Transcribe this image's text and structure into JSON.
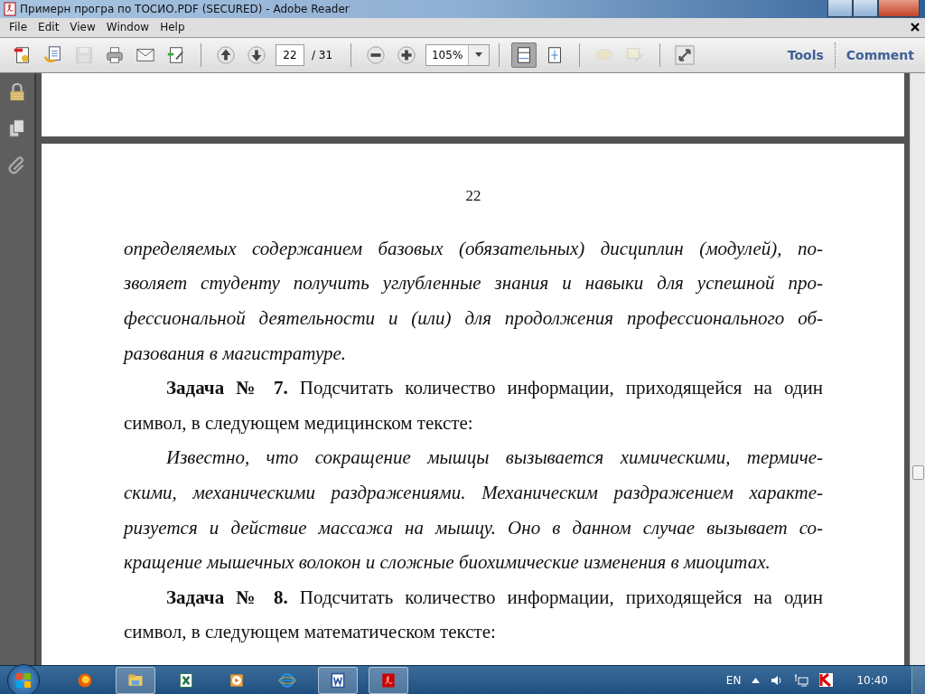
{
  "window": {
    "title": "Примерн програ по ТОСИО.PDF (SECURED) - Adobe Reader"
  },
  "menu": [
    "File",
    "Edit",
    "View",
    "Window",
    "Help"
  ],
  "toolbar": {
    "buttons": [
      {
        "kind": "create",
        "disabled": false,
        "pressed": false
      },
      {
        "kind": "open",
        "disabled": false,
        "pressed": false
      },
      {
        "kind": "save",
        "disabled": true,
        "pressed": false
      },
      {
        "kind": "print",
        "disabled": false,
        "pressed": false
      },
      {
        "kind": "email",
        "disabled": false,
        "pressed": false
      },
      {
        "kind": "sign",
        "disabled": false,
        "pressed": false
      },
      {
        "kind": "sep"
      },
      {
        "kind": "prev",
        "disabled": false,
        "pressed": false
      },
      {
        "kind": "next",
        "disabled": false,
        "pressed": false
      },
      {
        "kind": "page"
      },
      {
        "kind": "sep"
      },
      {
        "kind": "zoomout",
        "disabled": false,
        "pressed": false
      },
      {
        "kind": "zoomin",
        "disabled": false,
        "pressed": false
      },
      {
        "kind": "zoom"
      },
      {
        "kind": "sep"
      },
      {
        "kind": "fitpage",
        "disabled": false,
        "pressed": true
      },
      {
        "kind": "fitwidth",
        "disabled": false,
        "pressed": false
      },
      {
        "kind": "sep"
      },
      {
        "kind": "note",
        "disabled": true,
        "pressed": false
      },
      {
        "kind": "textedit",
        "disabled": true,
        "pressed": false
      },
      {
        "kind": "sep"
      },
      {
        "kind": "fullscreen",
        "disabled": false,
        "pressed": false
      }
    ],
    "page_number": "22",
    "page_count": "/ 31",
    "zoom": "105%",
    "links": [
      "Tools",
      "Comment"
    ]
  },
  "sidebar": [
    {
      "kind": "lock"
    },
    {
      "kind": "pages"
    },
    {
      "kind": "attachments"
    }
  ],
  "document": {
    "page_number": "22",
    "paragraphs": [
      {
        "kind": "italic",
        "indent": false,
        "lines": [
          "определяемых содержанием базовых (обязательных) дисциплин (модулей), по-",
          "зволяет студенту получить углубленные знания и навыки для успешной про-",
          "фессиональной деятельности и (или) для продолжения профессионального об-",
          "разования в магистратуре."
        ]
      },
      {
        "kind": "normal",
        "indent": true,
        "lines": [
          "**Задача № 7.** Подсчитать количество информации, приходящейся на один",
          "символ, в следующем медицинском тексте:"
        ]
      },
      {
        "kind": "italic",
        "indent": true,
        "lines": [
          "Известно, что сокращение мышцы вызывается химическими, термиче-",
          "скими, механическими раздражениями. Механическим раздражением характе-",
          "ризуется и действие массажа на мышцу. Оно в данном случае вызывает со-",
          "кращение мышечных волокон и сложные биохимические изменения в миоцитах."
        ]
      },
      {
        "kind": "normal",
        "indent": true,
        "lines": [
          "**Задача № 8.** Подсчитать количество информации, приходящейся на один",
          "символ, в следующем математическом тексте:"
        ]
      }
    ]
  },
  "taskbar": {
    "apps": [
      {
        "kind": "firefox",
        "open": false
      },
      {
        "kind": "explorer",
        "open": true
      },
      {
        "kind": "excel",
        "open": false
      },
      {
        "kind": "media",
        "open": false
      },
      {
        "kind": "ie",
        "open": false
      },
      {
        "kind": "word",
        "open": true
      },
      {
        "kind": "reader",
        "open": true
      }
    ],
    "language": "EN",
    "time": "10:40"
  }
}
